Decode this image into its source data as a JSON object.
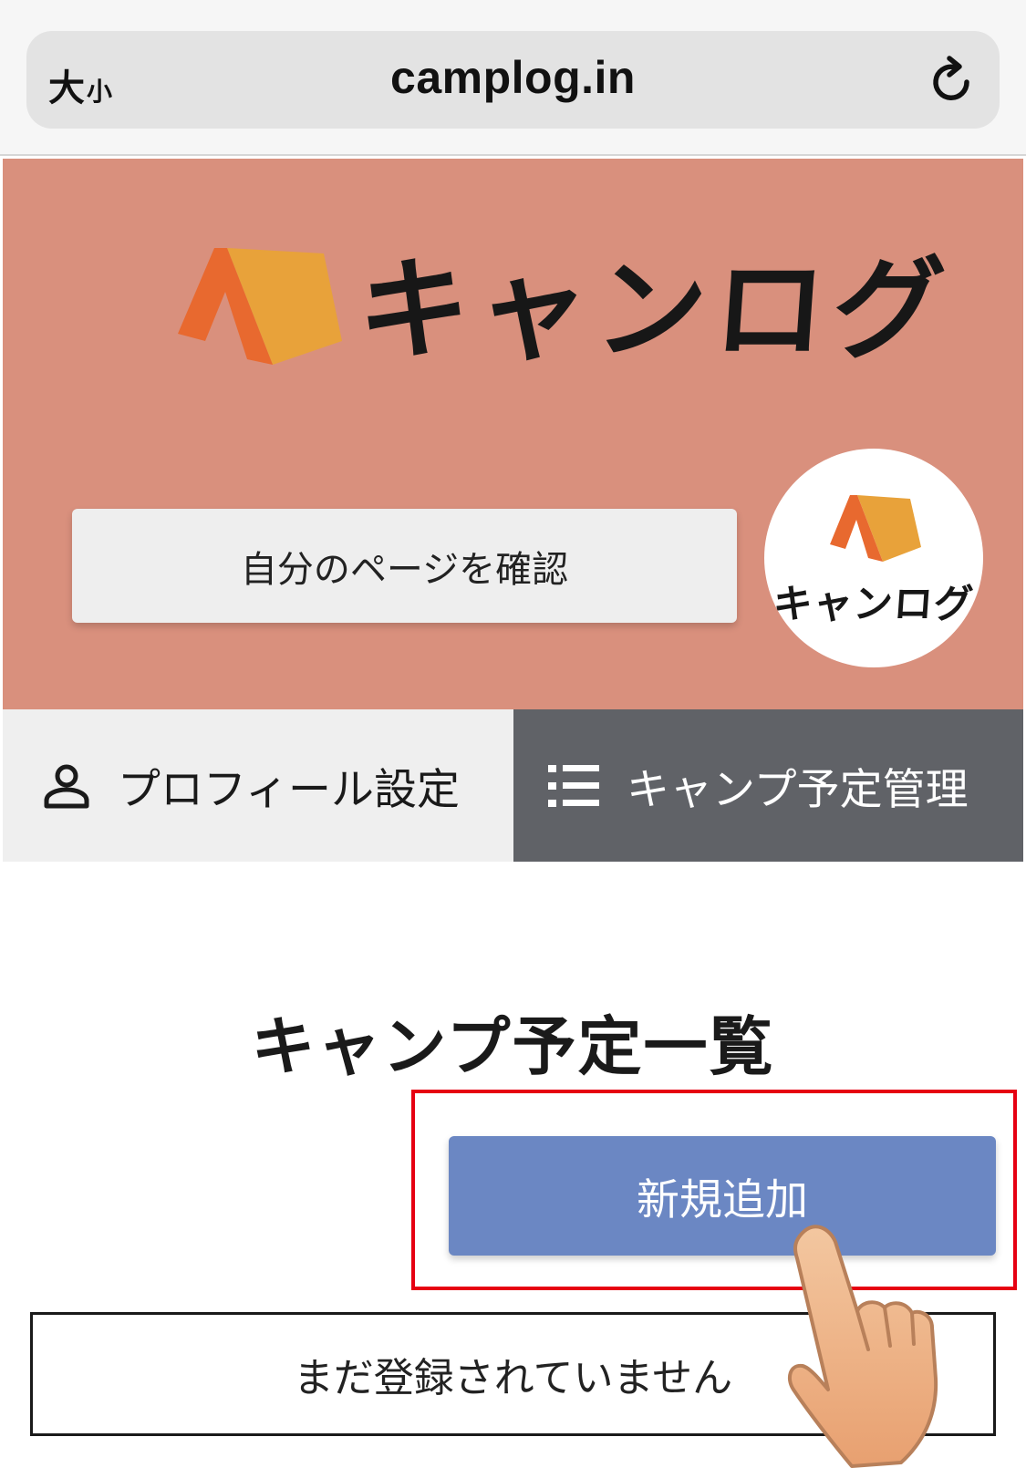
{
  "browser": {
    "text_size_big": "大",
    "text_size_small": "小",
    "url": "camplog.in",
    "reload_icon": "reload-icon"
  },
  "hero": {
    "logo_text": "キャンログ",
    "mypage_button_label": "自分のページを確認",
    "avatar_text": "キャンログ"
  },
  "tabs": [
    {
      "label": "プロフィール設定",
      "icon": "person-icon",
      "active": false
    },
    {
      "label": "キャンプ予定管理",
      "icon": "list-icon",
      "active": true
    }
  ],
  "main": {
    "title": "キャンプ予定一覧",
    "add_button_label": "新規追加",
    "empty_message": "まだ登録されていません"
  },
  "colors": {
    "hero_bg": "#d9907d",
    "tab_active_bg": "#606267",
    "tab_inactive_bg": "#efefef",
    "add_button_bg": "#6b87c3",
    "highlight_border": "#e60012",
    "tent_orange": "#e8692f",
    "tent_yellow": "#e8a23a"
  }
}
